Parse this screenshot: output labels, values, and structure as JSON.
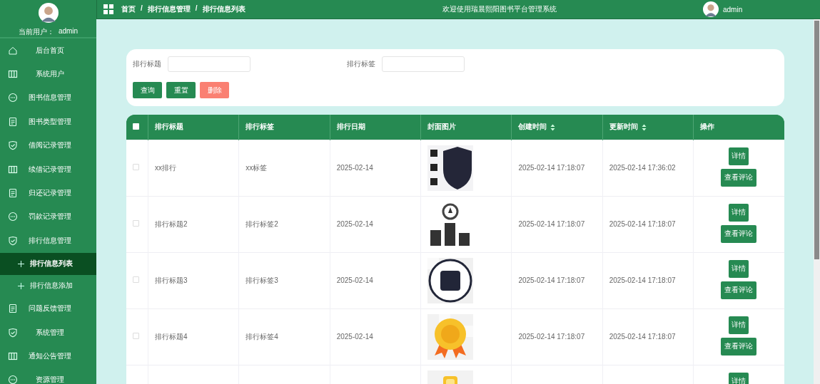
{
  "sidebar": {
    "user_label": "当前用户：",
    "user_name": "admin",
    "items": [
      {
        "label": "后台首页",
        "kind": "home"
      },
      {
        "label": "系统用户",
        "kind": "columns"
      },
      {
        "label": "图书信息管理",
        "kind": "chat"
      },
      {
        "label": "图书类型管理",
        "kind": "doc"
      },
      {
        "label": "借阅记录管理",
        "kind": "shield"
      },
      {
        "label": "续借记录管理",
        "kind": "columns"
      },
      {
        "label": "归还记录管理",
        "kind": "doc"
      },
      {
        "label": "罚款记录管理",
        "kind": "chat"
      },
      {
        "label": "排行信息管理",
        "kind": "shield",
        "children": [
          {
            "label": "排行信息列表",
            "selected": true
          },
          {
            "label": "排行信息添加",
            "selected": false
          }
        ]
      },
      {
        "label": "问题反馈管理",
        "kind": "doc"
      },
      {
        "label": "系统管理",
        "kind": "shield"
      },
      {
        "label": "通知公告管理",
        "kind": "columns"
      },
      {
        "label": "资源管理",
        "kind": "chat"
      }
    ]
  },
  "header": {
    "breadcrumb": [
      "首页",
      "排行信息管理",
      "排行信息列表"
    ],
    "separator": "/",
    "title": "欢迎使用瑞晨熙阳图书平台管理系统",
    "user": "admin"
  },
  "search": {
    "fields": [
      {
        "label": "排行标题"
      },
      {
        "label": "排行标签"
      }
    ],
    "buttons": [
      {
        "label": "查询",
        "kind": "primary"
      },
      {
        "label": "重置",
        "kind": "primary"
      },
      {
        "label": "删除",
        "kind": "danger"
      }
    ]
  },
  "table": {
    "select_all": false,
    "columns": [
      {
        "label": "排行标题",
        "sortable": false
      },
      {
        "label": "排行标签",
        "sortable": false
      },
      {
        "label": "排行日期",
        "sortable": false
      },
      {
        "label": "封面图片",
        "sortable": false
      },
      {
        "label": "创建时间",
        "sortable": true
      },
      {
        "label": "更新时间",
        "sortable": true
      },
      {
        "label": "操作",
        "sortable": false
      }
    ],
    "rows": [
      {
        "checked": false,
        "title": "xx排行",
        "tag": "xx标签",
        "date": "2025-02-14",
        "cover": {
          "kind": "picture"
        },
        "created": "2025-02-14 17:18:07",
        "updated": "2025-02-14 17:36:02",
        "actions": [
          "详情",
          "查看评论"
        ]
      },
      {
        "checked": false,
        "title": "排行标题2",
        "tag": "排行标签2",
        "date": "2025-02-14",
        "cover": {
          "kind": "picture"
        },
        "created": "2025-02-14 17:18:07",
        "updated": "2025-02-14 17:18:07",
        "actions": [
          "详情",
          "查看评论"
        ]
      },
      {
        "checked": false,
        "title": "排行标题3",
        "tag": "排行标签3",
        "date": "2025-02-14",
        "cover": {
          "kind": "picture"
        },
        "created": "2025-02-14 17:18:07",
        "updated": "2025-02-14 17:18:07",
        "actions": [
          "详情",
          "查看评论"
        ]
      },
      {
        "checked": false,
        "title": "排行标题4",
        "tag": "排行标签4",
        "date": "2025-02-14",
        "cover": {
          "kind": "picture"
        },
        "created": "2025-02-14 17:18:07",
        "updated": "2025-02-14 17:18:07",
        "actions": [
          "详情",
          "查看评论"
        ]
      },
      {
        "cover": {
          "kind": "picture"
        },
        "actions": [
          "详情"
        ]
      }
    ]
  }
}
